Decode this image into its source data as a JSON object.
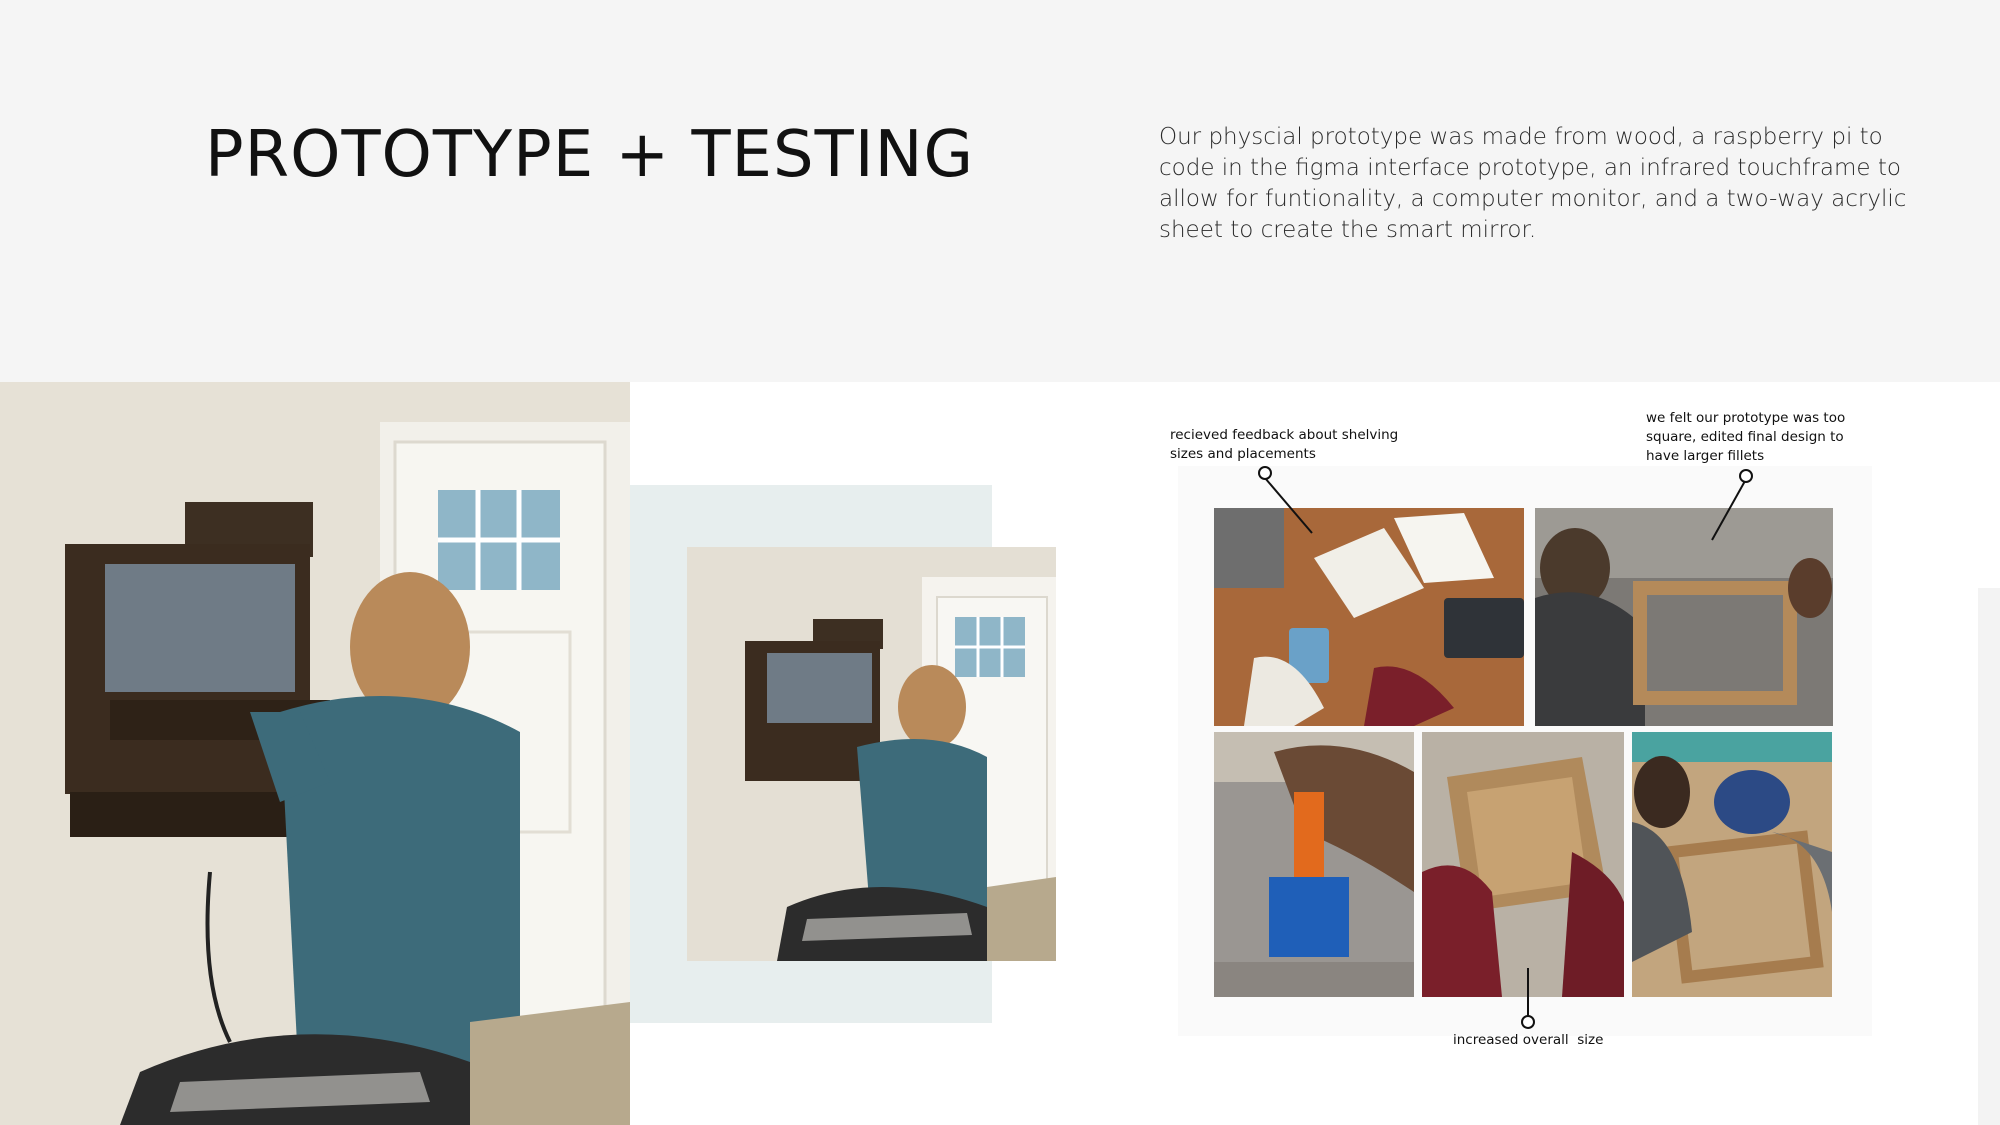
{
  "header": {
    "title": "PROTOTYPE + TESTING",
    "description": "Our physcial prototype was made from wood, a raspberry pi to code in the figma interface prototype, an infrared touchframe to allow for funtionality, a computer monitor, and a two-way acrylic sheet to create the smart mirror."
  },
  "annotations": {
    "shelving": "recieved feedback about shelving sizes and placements",
    "fillets": "we felt our prototype was too square, edited final design to have larger fillets",
    "size": "increased overall  size"
  },
  "colors": {
    "header_background": "#f5f5f5",
    "panel_background": "#e7eeee",
    "text": "#111111"
  }
}
